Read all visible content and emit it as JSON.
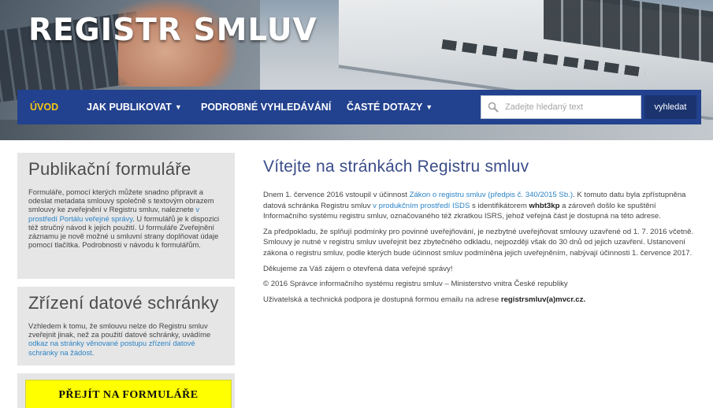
{
  "site": {
    "title": "REGISTR SMLUV"
  },
  "nav": {
    "items": [
      {
        "label": "ÚVOD",
        "active": true,
        "dropdown": false
      },
      {
        "label": "JAK PUBLIKOVAT",
        "active": false,
        "dropdown": true
      },
      {
        "label": "PODROBNÉ VYHLEDÁVÁNÍ",
        "active": false,
        "dropdown": false
      },
      {
        "label": "ČASTÉ DOTAZY",
        "active": false,
        "dropdown": true
      }
    ],
    "search": {
      "placeholder": "Zadejte hledaný text",
      "button": "vyhledat",
      "icon": "search-icon"
    },
    "colors": {
      "bar": "#22418e",
      "active": "#f6c514"
    }
  },
  "sidebar": {
    "forms": {
      "title": "Publikační formuláře",
      "text1": "Formuláře, pomocí kterých můžete snadno připravit a odeslat metadata smlouvy společně s textovým obrazem smlouvy ke zveřejnění v Registru smluv, naleznete ",
      "link": "v prostředí Portálu veřejné správy",
      "text2": ". U formulářů je k dispozici též stručný návod k jejich použití. U formuláře Zveřejnění záznamu je nově možné u smluvní strany doplňovat údaje pomocí tlačítka. Podrobnosti v návodu k formulářům."
    },
    "databox": {
      "title": "Zřízení datové schránky",
      "text1": "Vzhledem k tomu, že smlouvu nelze do Registru smluv zveřejnit jinak, než za použití datové schránky, uvádíme ",
      "link": "odkaz na stránky věnované postupu zřízení datové schránky na žádost",
      "text2": "."
    },
    "cta": {
      "label": "PŘEJÍT NA FORMULÁŘE",
      "color": "#ffff00"
    }
  },
  "main": {
    "title": "Vítejte na stránkách Registru smluv",
    "p1": {
      "a": "Dnem 1. července 2016 vstoupil v účinnost ",
      "link1": "Zákon o registru smluv (předpis č. 340/2015 Sb.)",
      "b": ". K tomuto datu byla zpřístupněna datová schránka Registru smluv ",
      "link2": "v produkčním prostředí ISDS",
      "c": " s identifikátorem ",
      "id": "whbt3kp",
      "d": " a zároveň došlo ke spuštění Informačního systému registru smluv, označovaného též zkratkou ISRS, jehož veřejná část je dostupná na této adrese."
    },
    "p2": "Za předpokladu, že splňují podmínky pro povinné uveřejňování, je nezbytné uveřejňovat smlouvy uzavřené od 1. 7. 2016 včetně. Smlouvy je nutné v registru smluv uveřejnit bez zbytečného odkladu, nejpozději však do 30 dnů od jejich uzavření. Ustanovení zákona o registru smluv, podle kterých bude účinnost smluv podmíněna jejich uveřejněním, nabývají účinnosti 1. července 2017.",
    "p3": "Děkujeme za Váš zájem o otevřená data veřejné správy!",
    "p4": "© 2016 Správce informačního systému registru smluv – Ministerstvo vnitra České republiky",
    "p5": {
      "a": "Uživatelská a technická podpora je dostupná formou emailu na adrese ",
      "email": "registrsmluv(a)mvcr.cz."
    }
  }
}
